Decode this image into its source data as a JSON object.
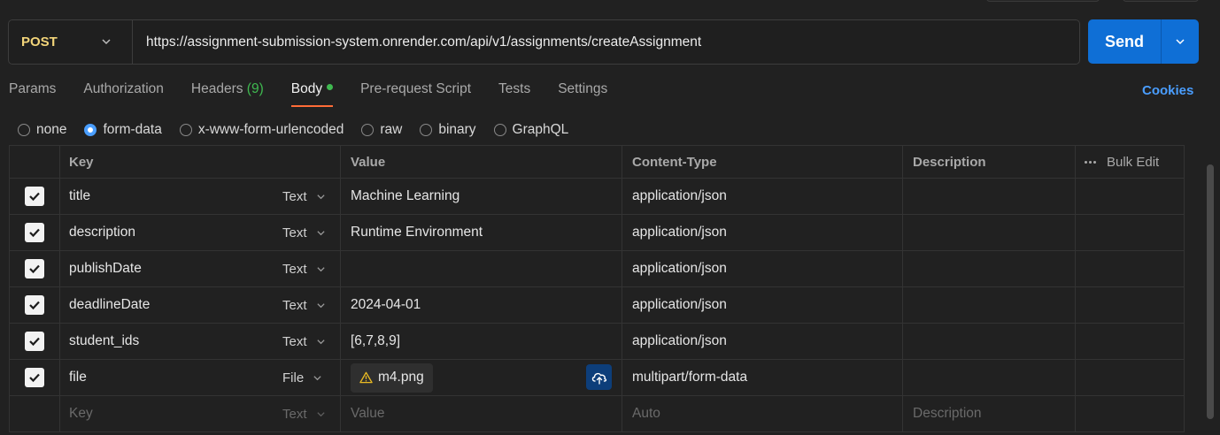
{
  "request": {
    "method": "POST",
    "url": "https://assignment-submission-system.onrender.com/api/v1/assignments/createAssignment",
    "send_label": "Send"
  },
  "tabs": [
    {
      "label": "Params"
    },
    {
      "label": "Authorization"
    },
    {
      "label": "Headers",
      "count": "(9)"
    },
    {
      "label": "Body"
    },
    {
      "label": "Pre-request Script"
    },
    {
      "label": "Tests"
    },
    {
      "label": "Settings"
    }
  ],
  "cookies_label": "Cookies",
  "body_types": [
    "none",
    "form-data",
    "x-www-form-urlencoded",
    "raw",
    "binary",
    "GraphQL"
  ],
  "selected_body_type": "form-data",
  "table": {
    "headers": {
      "key": "Key",
      "value": "Value",
      "content_type": "Content-Type",
      "description": "Description",
      "bulk_edit": "Bulk Edit"
    },
    "rows": [
      {
        "key": "title",
        "type": "Text",
        "value": "Machine Learning",
        "content_type": "application/json"
      },
      {
        "key": "description",
        "type": "Text",
        "value": "Runtime Environment",
        "content_type": "application/json"
      },
      {
        "key": "publishDate",
        "type": "Text",
        "value": "",
        "content_type": "application/json"
      },
      {
        "key": "deadlineDate",
        "type": "Text",
        "value": "2024-04-01",
        "content_type": "application/json"
      },
      {
        "key": "student_ids",
        "type": "Text",
        "value": "[6,7,8,9]",
        "content_type": "application/json"
      },
      {
        "key": "file",
        "type": "File",
        "value": "m4.png",
        "content_type": "multipart/form-data"
      }
    ],
    "placeholder": {
      "key": "Key",
      "type": "Text",
      "value": "Value",
      "content_type": "Auto",
      "description": "Description"
    }
  },
  "colors": {
    "background": "#212121",
    "method": "#f3d57a",
    "send_button": "#0f6fd6",
    "active_tab_underline": "#ff6c37",
    "body_dot": "#3fb950",
    "link": "#4a9eff"
  }
}
